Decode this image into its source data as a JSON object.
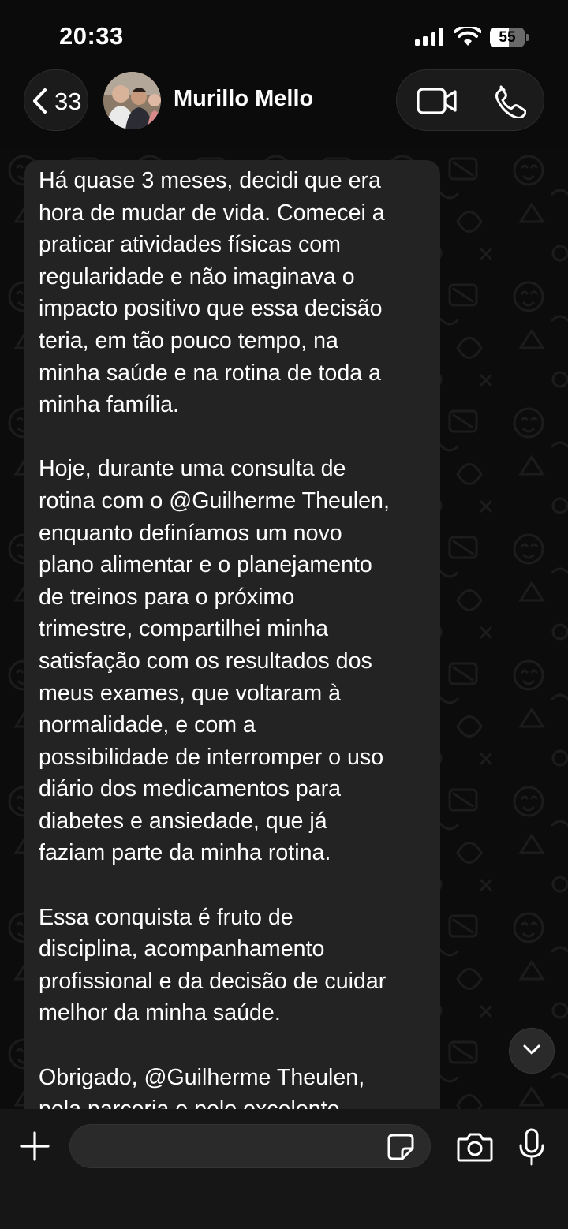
{
  "status_bar": {
    "time": "20:33",
    "battery_level": "55",
    "battery_fraction": 0.55
  },
  "header": {
    "back_count": "33",
    "contact_name": "Murillo Mello",
    "icons": [
      "chevron-left-icon",
      "video-call-icon",
      "phone-call-icon"
    ]
  },
  "message": {
    "text": "Há quase 3 meses, decidi que era\nhora de mudar de vida. Comecei a\npraticar atividades físicas com\nregularidade e não imaginava o\nimpacto positivo que essa decisão\nteria, em tão pouco tempo, na\nminha saúde e na rotina de toda a\nminha família.\n\nHoje, durante uma consulta de\nrotina com o @Guilherme Theulen,\nenquanto definíamos um novo\nplano alimentar e o planejamento\nde treinos para o próximo\ntrimestre, compartilhei minha\nsatisfação com os resultados dos\nmeus exames, que voltaram à\nnormalidade, e com a\npossibilidade de interromper o uso\ndiário dos medicamentos para\ndiabetes e ansiedade, que já\nfaziam parte da minha rotina.\n\nEssa conquista é fruto de\ndisciplina, acompanhamento\nprofissional e da decisão de cuidar\nmelhor da minha saúde.\n\nObrigado, @Guilherme Theulen,\npela parceria e pelo excelente"
  },
  "input_bar": {
    "value": "",
    "placeholder": "",
    "icons": [
      "plus-icon",
      "sticker-icon",
      "camera-icon",
      "microphone-icon"
    ]
  },
  "colors": {
    "background": "#0b0b0b",
    "bubble": "#232323",
    "input_bar": "#161616",
    "text": "#ffffff"
  }
}
